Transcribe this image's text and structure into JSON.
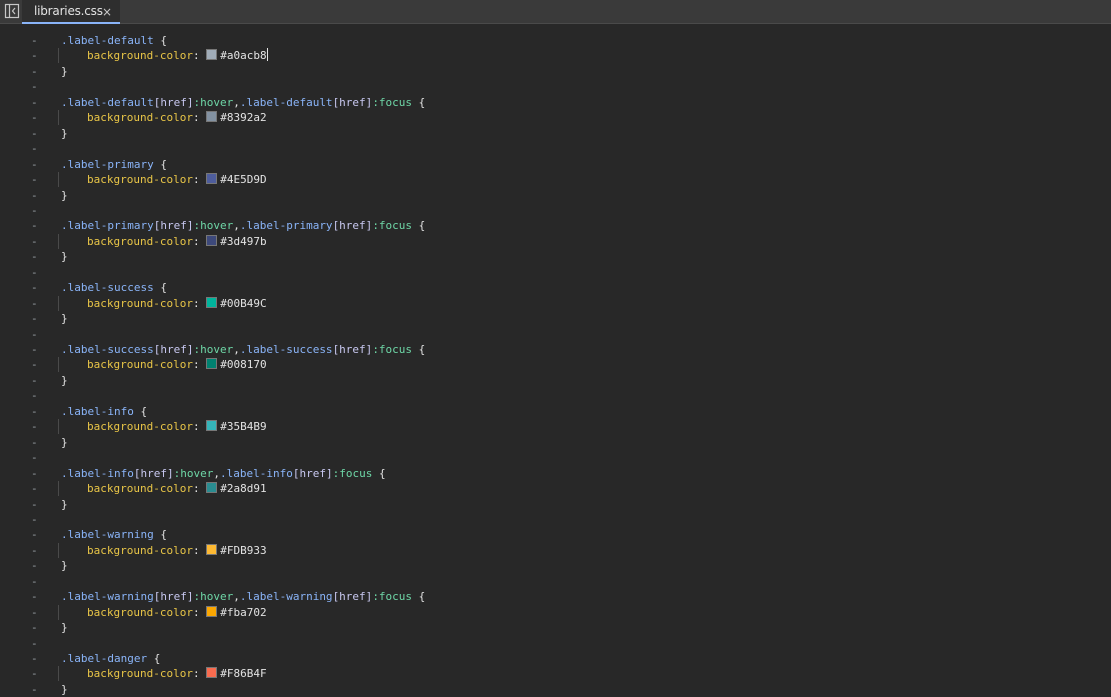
{
  "tab": {
    "filename": "libraries.css",
    "close_glyph": "×"
  },
  "gutter_marker": "-",
  "rules": [
    {
      "selector": [
        ".label-default"
      ],
      "value": "#a0acb8",
      "swatch": "#a0acb8",
      "caret": true
    },
    {
      "selector": [
        ".label-default",
        "[href]",
        ":hover",
        ",",
        ".label-default",
        "[href]",
        ":focus"
      ],
      "value": "#8392a2",
      "swatch": "#8392a2"
    },
    {
      "selector": [
        ".label-primary"
      ],
      "value": "#4E5D9D",
      "swatch": "#4E5D9D"
    },
    {
      "selector": [
        ".label-primary",
        "[href]",
        ":hover",
        ",",
        ".label-primary",
        "[href]",
        ":focus"
      ],
      "value": "#3d497b",
      "swatch": "#3d497b"
    },
    {
      "selector": [
        ".label-success"
      ],
      "value": "#00B49C",
      "swatch": "#00B49C"
    },
    {
      "selector": [
        ".label-success",
        "[href]",
        ":hover",
        ",",
        ".label-success",
        "[href]",
        ":focus"
      ],
      "value": "#008170",
      "swatch": "#008170"
    },
    {
      "selector": [
        ".label-info"
      ],
      "value": "#35B4B9",
      "swatch": "#35B4B9"
    },
    {
      "selector": [
        ".label-info",
        "[href]",
        ":hover",
        ",",
        ".label-info",
        "[href]",
        ":focus"
      ],
      "value": "#2a8d91",
      "swatch": "#2a8d91"
    },
    {
      "selector": [
        ".label-warning"
      ],
      "value": "#FDB933",
      "swatch": "#FDB933"
    },
    {
      "selector": [
        ".label-warning",
        "[href]",
        ":hover",
        ",",
        ".label-warning",
        "[href]",
        ":focus"
      ],
      "value": "#fba702",
      "swatch": "#fba702"
    },
    {
      "selector": [
        ".label-danger"
      ],
      "value": "#F86B4F",
      "swatch": "#F86B4F"
    }
  ],
  "property": "background-color",
  "colon": ":",
  "open_brace": "{",
  "close_brace": "}"
}
